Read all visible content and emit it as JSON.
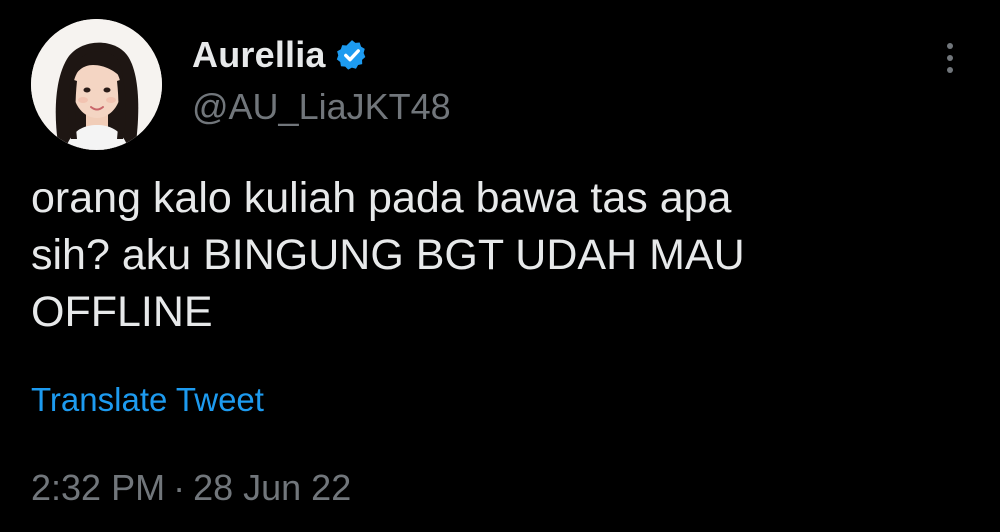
{
  "author": {
    "display_name": "Aurellia",
    "handle": "@AU_LiaJKT48",
    "verified": true,
    "avatar_icon": "profile-photo"
  },
  "tweet": {
    "lines": [
      "orang kalo kuliah pada bawa tas apa",
      "sih? aku BINGUNG BGT UDAH MAU",
      "OFFLINE"
    ],
    "translate_label": "Translate Tweet",
    "time": "2:32 PM",
    "separator": "·",
    "date": "28 Jun 22"
  },
  "menu": {
    "icon": "more-vertical-icon"
  },
  "colors": {
    "background": "#000000",
    "text_primary": "#e7e9ea",
    "text_secondary": "#71767b",
    "link": "#1d9bf0",
    "verified_badge": "#1d9bf0"
  }
}
